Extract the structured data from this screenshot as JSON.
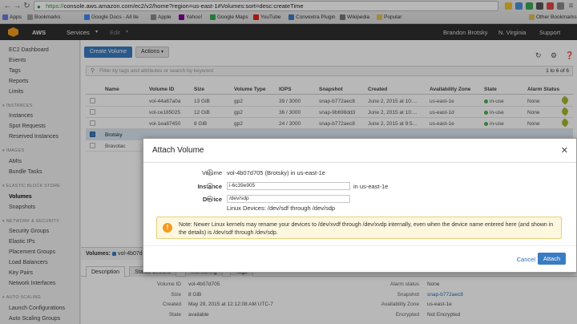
{
  "browser": {
    "url_https": "https://",
    "url_rest": "console.aws.amazon.com/ec2/v2/home?region=us-east-1#Volumes:sort=desc:createTime",
    "bookmarks": [
      {
        "label": "Apps",
        "color": "#6e7bd9"
      },
      {
        "label": "Bookmarks",
        "color": "#9e9e9e"
      },
      {
        "label": "Google Docs - All ite",
        "color": "#4285f4"
      },
      {
        "label": "Apple",
        "color": "#888888"
      },
      {
        "label": "Yahoo!",
        "color": "#7b0099"
      },
      {
        "label": "Google Maps",
        "color": "#34a853"
      },
      {
        "label": "YouTube",
        "color": "#e62117"
      },
      {
        "label": "Convextra Plugin",
        "color": "#3a7cc1"
      },
      {
        "label": "Wikipedia",
        "color": "#777777"
      },
      {
        "label": "Popular",
        "color": "#e0c050"
      },
      {
        "label": "Other Bookmarks",
        "color": "#e0c050"
      }
    ]
  },
  "aws_header": {
    "brand": "AWS",
    "services": "Services",
    "edit": "Edit",
    "user": "Brandon Brotsky",
    "region": "N. Virginia",
    "support": "Support"
  },
  "sidebar": {
    "items": [
      {
        "label": "EC2 Dashboard",
        "type": "link"
      },
      {
        "label": "Events",
        "type": "link"
      },
      {
        "label": "Tags",
        "type": "link"
      },
      {
        "label": "Reports",
        "type": "link"
      },
      {
        "label": "Limits",
        "type": "link"
      },
      {
        "label": "INSTANCES",
        "type": "head"
      },
      {
        "label": "Instances",
        "type": "link"
      },
      {
        "label": "Spot Requests",
        "type": "link"
      },
      {
        "label": "Reserved Instances",
        "type": "link"
      },
      {
        "label": "IMAGES",
        "type": "head"
      },
      {
        "label": "AMIs",
        "type": "link"
      },
      {
        "label": "Bundle Tasks",
        "type": "link"
      },
      {
        "label": "ELASTIC BLOCK STORE",
        "type": "head"
      },
      {
        "label": "Volumes",
        "type": "link",
        "active": true
      },
      {
        "label": "Snapshots",
        "type": "link"
      },
      {
        "label": "NETWORK & SECURITY",
        "type": "head"
      },
      {
        "label": "Security Groups",
        "type": "link"
      },
      {
        "label": "Elastic IPs",
        "type": "link"
      },
      {
        "label": "Placement Groups",
        "type": "link"
      },
      {
        "label": "Load Balancers",
        "type": "link"
      },
      {
        "label": "Key Pairs",
        "type": "link"
      },
      {
        "label": "Network Interfaces",
        "type": "link"
      },
      {
        "label": "AUTO SCALING",
        "type": "head"
      },
      {
        "label": "Launch Configurations",
        "type": "link"
      },
      {
        "label": "Auto Scaling Groups",
        "type": "link"
      }
    ]
  },
  "toolbar": {
    "create_volume": "Create Volume",
    "actions": "Actions",
    "filter_placeholder": "Filter by tags and attributes or search by keyword",
    "pager": "1 to 6 of 6"
  },
  "table": {
    "headers": [
      "Name",
      "Volume ID",
      "Size",
      "Volume Type",
      "IOPS",
      "Snapshot",
      "Created",
      "Availability Zone",
      "State",
      "Alarm Status"
    ],
    "rows": [
      {
        "name": "",
        "id": "vol-44a67a0a",
        "size": "13 GiB",
        "type": "gp2",
        "iops": "39 / 3000",
        "snapshot": "snap-b772aec8",
        "created": "June 2, 2015 at 10:...",
        "zone": "us-east-1e",
        "state": "in-use",
        "alarm": "None",
        "selected": false
      },
      {
        "name": "",
        "id": "vol-ce185025",
        "size": "12 GiB",
        "type": "gp2",
        "iops": "36 / 3000",
        "snapshot": "snap-9b698dd3",
        "created": "June 2, 2015 at 10:...",
        "zone": "us-east-1d",
        "state": "in-use",
        "alarm": "None",
        "selected": false
      },
      {
        "name": "",
        "id": "vol-1ea87450",
        "size": "8 GiB",
        "type": "gp2",
        "iops": "24 / 3000",
        "snapshot": "snap-b772aec8",
        "created": "June 2, 2015 at 9:5...",
        "zone": "us-east-1e",
        "state": "in-use",
        "alarm": "None",
        "selected": false
      },
      {
        "name": "Brotsky",
        "id": "",
        "size": "",
        "type": "",
        "iops": "",
        "snapshot": "",
        "created": "",
        "zone": "",
        "state": "",
        "alarm": "",
        "selected": true
      },
      {
        "name": "Bravotac",
        "id": "",
        "size": "",
        "type": "",
        "iops": "",
        "snapshot": "",
        "created": "",
        "zone": "",
        "state": "",
        "alarm": "",
        "selected": false
      }
    ]
  },
  "detail": {
    "bar_label": "Volumes:",
    "bar_value": "vol-4b07d",
    "tabs": [
      "Description",
      "Status Checks",
      "Monitoring",
      "Tags"
    ],
    "left": [
      {
        "label": "Volume ID",
        "value": "vol-4b07d705"
      },
      {
        "label": "Size",
        "value": "8 GiB"
      },
      {
        "label": "Created",
        "value": "May 29, 2015 at 12:12:08 AM UTC-7"
      },
      {
        "label": "State",
        "value": "available"
      }
    ],
    "right": [
      {
        "label": "Alarm status",
        "value": "None",
        "link": false
      },
      {
        "label": "Snapshot",
        "value": "snap-b772aec8",
        "link": true
      },
      {
        "label": "Availability Zone",
        "value": "us-east-1e",
        "link": false
      },
      {
        "label": "Encrypted",
        "value": "Not Encrypted",
        "link": false
      }
    ]
  },
  "modal": {
    "title": "Attach Volume",
    "volume_label": "Volume",
    "volume_value": "vol-4b07d705 (Brotsky) in us-east-1e",
    "instance_label": "Instance",
    "instance_value": "i-6c39e905",
    "instance_suffix": "in us-east-1e",
    "device_label": "Device",
    "device_value": "/dev/sdp",
    "device_hint": "Linux Devices: /dev/sdf through /dev/sdp",
    "warning": "Note: Newer Linux kernels may rename your devices to /dev/xvdf through /dev/xvdp internally, even when the device name entered here (and shown in the details) is /dev/sdf through /dev/sdp.",
    "cancel": "Cancel",
    "attach": "Attach"
  }
}
